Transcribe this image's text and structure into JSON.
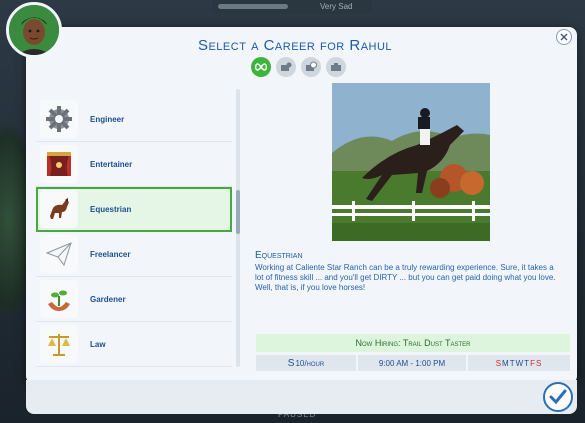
{
  "background": {
    "top_status": "Very Sad",
    "bottom_tag": "PAUSED"
  },
  "dialog": {
    "title": "Select a Career for Rahul",
    "filters": [
      {
        "icon": "infinity-icon",
        "active": true
      },
      {
        "icon": "part-time-icon",
        "active": false
      },
      {
        "icon": "clock-icon",
        "active": false
      },
      {
        "icon": "briefcase-icon",
        "active": false
      }
    ]
  },
  "careers": [
    {
      "label": "Engineer",
      "icon": "gear-icon"
    },
    {
      "label": "Entertainer",
      "icon": "stage-curtain-icon"
    },
    {
      "label": "Equestrian",
      "icon": "horse-icon",
      "selected": true
    },
    {
      "label": "Freelancer",
      "icon": "paper-plane-icon"
    },
    {
      "label": "Gardener",
      "icon": "plant-hands-icon"
    },
    {
      "label": "Law",
      "icon": "scales-icon"
    }
  ],
  "detail": {
    "name": "Equestrian",
    "description": "Working at Caliente Star Ranch can be a truly rewarding experience. Sure, it takes a lot of fitness skill ... and you'll get DIRTY ... but you can get paid doing what you love. Well, that is, if you love horses!",
    "hiring": "Now Hiring: Trail Dust Taster",
    "pay_symbol": "S",
    "pay": "10/hour",
    "hours": "9:00 AM - 1:00 PM",
    "days": [
      {
        "d": "S",
        "work": true
      },
      {
        "d": "M",
        "work": false
      },
      {
        "d": "T",
        "work": false
      },
      {
        "d": "W",
        "work": false
      },
      {
        "d": "T",
        "work": false
      },
      {
        "d": "F",
        "work": true
      },
      {
        "d": "S",
        "work": true
      }
    ]
  },
  "colors": {
    "accent": "#1d5aa8",
    "selected": "#45a93f",
    "work_day": "#d22a2a"
  }
}
